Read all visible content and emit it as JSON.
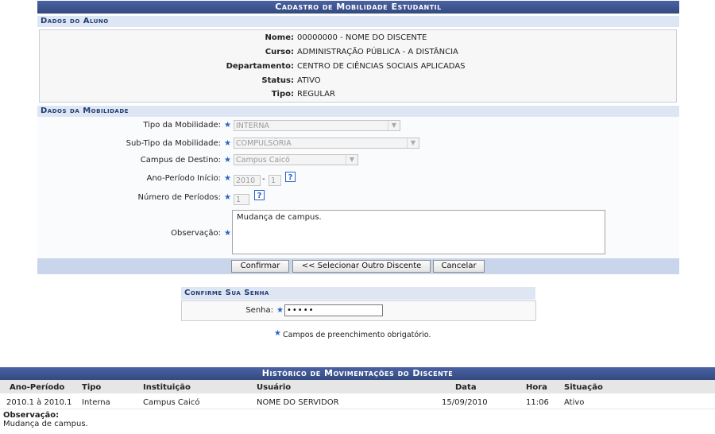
{
  "title": "Cadastro de Mobilidade Estudantil",
  "aluno": {
    "section": "Dados do Aluno",
    "fields": [
      {
        "label": "Nome:",
        "value": "00000000 - NOME DO DISCENTE"
      },
      {
        "label": "Curso:",
        "value": "ADMINISTRAÇÃO PÚBLICA - A DISTÂNCIA"
      },
      {
        "label": "Departamento:",
        "value": "CENTRO DE CIÊNCIAS SOCIAIS APLICADAS"
      },
      {
        "label": "Status:",
        "value": "ATIVO"
      },
      {
        "label": "Tipo:",
        "value": "REGULAR"
      }
    ]
  },
  "mobilidade": {
    "section": "Dados da Mobilidade",
    "tipo_label": "Tipo da Mobilidade:",
    "tipo_value": "INTERNA",
    "subtipo_label": "Sub-Tipo da Mobilidade:",
    "subtipo_value": "COMPULSÓRIA",
    "campus_label": "Campus de Destino:",
    "campus_value": "Campus Caicó",
    "ano_label": "Ano-Período Início:",
    "ano_value": "2010",
    "periodo_value": "1",
    "sep": "-",
    "num_label": "Número de Períodos:",
    "num_value": "1",
    "obs_label": "Observação:",
    "obs_value": "Mudança de campus.",
    "help_glyph": "?"
  },
  "buttons": {
    "confirmar": "Confirmar",
    "selecionar": "<< Selecionar Outro Discente",
    "cancelar": "Cancelar"
  },
  "senha": {
    "section": "Confirme Sua Senha",
    "label": "Senha:",
    "value": "•••••"
  },
  "required_note": "Campos de preenchimento obrigatório.",
  "required_star": "★",
  "historico": {
    "title": "Histórico de Movimentações do Discente",
    "headers": {
      "ano": "Ano-Período",
      "tipo": "Tipo",
      "instituicao": "Instituição",
      "usuario": "Usuário",
      "data": "Data",
      "hora": "Hora",
      "situacao": "Situação"
    },
    "row": {
      "ano": "2010.1 à 2010.1",
      "tipo": "Interna",
      "instituicao": "Campus Caicó",
      "usuario": "NOME DO SERVIDOR",
      "data": "15/09/2010",
      "hora": "11:06",
      "situacao": "Ativo"
    },
    "obs_label": "Observação:",
    "obs_value": "Mudança de campus."
  },
  "colors": {
    "title_bar": "#3b5998",
    "section_bg": "#dfe6f3",
    "required_star": "#2a63c9"
  }
}
